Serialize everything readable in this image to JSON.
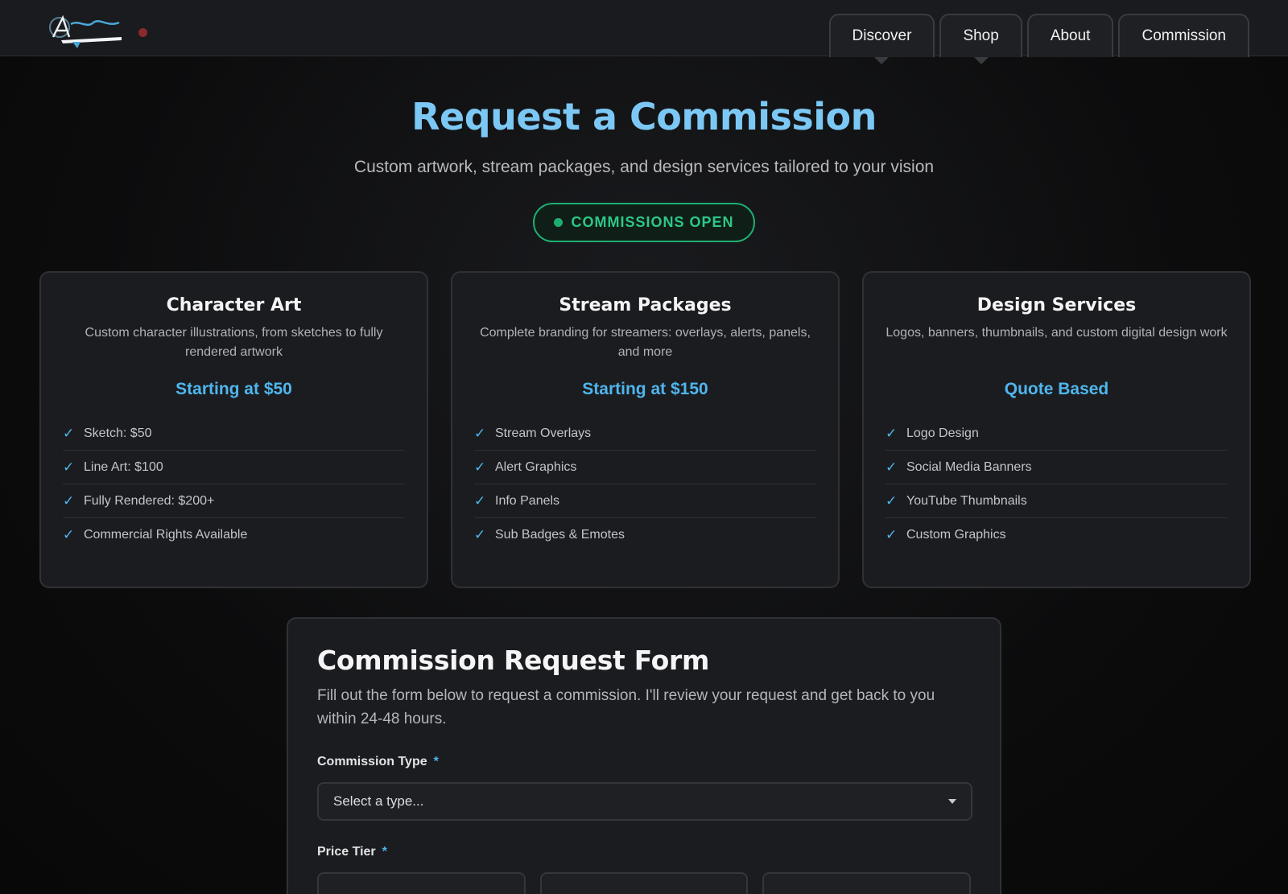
{
  "nav": {
    "tabs": [
      {
        "label": "Discover"
      },
      {
        "label": "Shop"
      },
      {
        "label": "About"
      },
      {
        "label": "Commission"
      }
    ]
  },
  "hero": {
    "title": "Request a Commission",
    "subtitle": "Custom artwork, stream packages, and design services tailored to your vision",
    "status": "COMMISSIONS OPEN"
  },
  "colors": {
    "accent": "#4fb6ee",
    "title": "#7cc8f5",
    "status_green": "#1fae72",
    "background": "#0c0c0d"
  },
  "cards": [
    {
      "title": "Character Art",
      "desc": "Custom character illustrations, from sketches to fully rendered artwork",
      "price": "Starting at $50",
      "features": [
        "Sketch: $50",
        "Line Art: $100",
        "Fully Rendered: $200+",
        "Commercial Rights Available"
      ]
    },
    {
      "title": "Stream Packages",
      "desc": "Complete branding for streamers: overlays, alerts, panels, and more",
      "price": "Starting at $150",
      "features": [
        "Stream Overlays",
        "Alert Graphics",
        "Info Panels",
        "Sub Badges & Emotes"
      ]
    },
    {
      "title": "Design Services",
      "desc": "Logos, banners, thumbnails, and custom digital design work",
      "price": "Quote Based",
      "features": [
        "Logo Design",
        "Social Media Banners",
        "YouTube Thumbnails",
        "Custom Graphics"
      ]
    }
  ],
  "form": {
    "title": "Commission Request Form",
    "desc": "Fill out the form below to request a commission. I'll review your request and get back to you within 24-48 hours.",
    "type_label": "Commission Type",
    "required_mark": "*",
    "type_value": "Select a type...",
    "tier_label": "Price Tier"
  }
}
